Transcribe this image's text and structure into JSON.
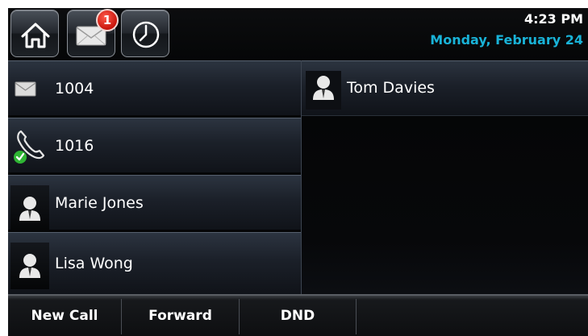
{
  "header": {
    "buttons": [
      {
        "name": "home",
        "icon": "home-icon"
      },
      {
        "name": "messages",
        "icon": "envelope-icon",
        "badge": "1"
      },
      {
        "name": "recent-calls",
        "icon": "clock-icon"
      }
    ],
    "time": "4:23 PM",
    "date": "Monday, February 24",
    "date_color": "#19b3d8"
  },
  "lines": [
    {
      "label": "1004",
      "icon": "envelope-icon"
    },
    {
      "label": "1016",
      "icon": "registered-phone-icon"
    },
    {
      "label": "Marie Jones",
      "icon": "user-icon"
    },
    {
      "label": "Lisa Wong",
      "icon": "user-icon"
    }
  ],
  "favorites": [
    {
      "label": "Tom Davies",
      "icon": "user-icon"
    }
  ],
  "softkeys": [
    {
      "label": "New Call"
    },
    {
      "label": "Forward"
    },
    {
      "label": "DND"
    }
  ]
}
